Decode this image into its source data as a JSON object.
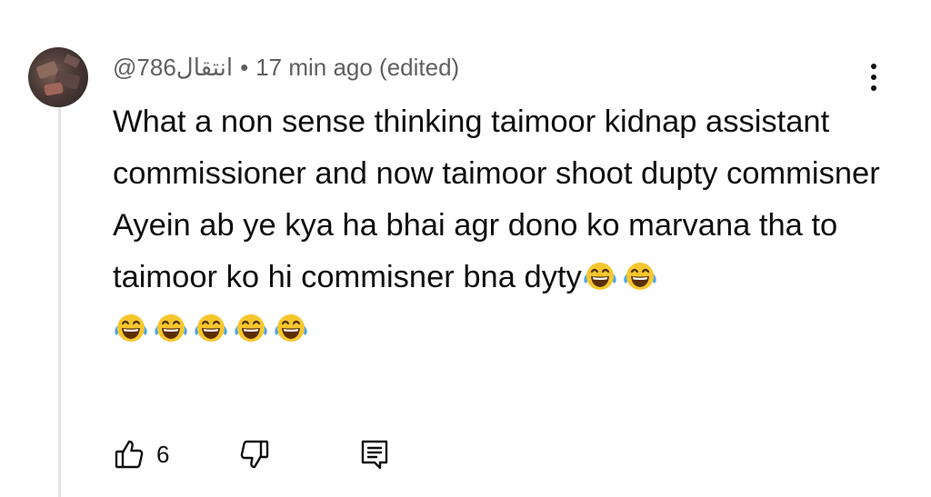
{
  "comment": {
    "author": "@انتقال786",
    "separator": "•",
    "timestamp": "17 min ago (edited)",
    "paragraphs": [
      "What a non sense thinking taimoor kidnap assistant commissioner and now taimoor shoot dupty commisner",
      "Ayein ab ye kya ha bhai agr dono ko marvana tha to taimoor ko hi commisner bna dyty"
    ],
    "emoji": {
      "name": "face-with-tears-of-joy",
      "glyph": "😂",
      "inline_count": 2,
      "next_line_count": 5
    },
    "like_count": "6"
  },
  "icons": {
    "avatar": "user-avatar-image",
    "menu": "more-vertical-icon",
    "like": "thumbs-up-icon",
    "dislike": "thumbs-down-icon",
    "reply": "reply-comment-icon"
  },
  "colors": {
    "text": "#0f0f0f",
    "meta": "#606060",
    "thread_line": "#e3e3e3",
    "emoji_face": "#f7c62f"
  }
}
